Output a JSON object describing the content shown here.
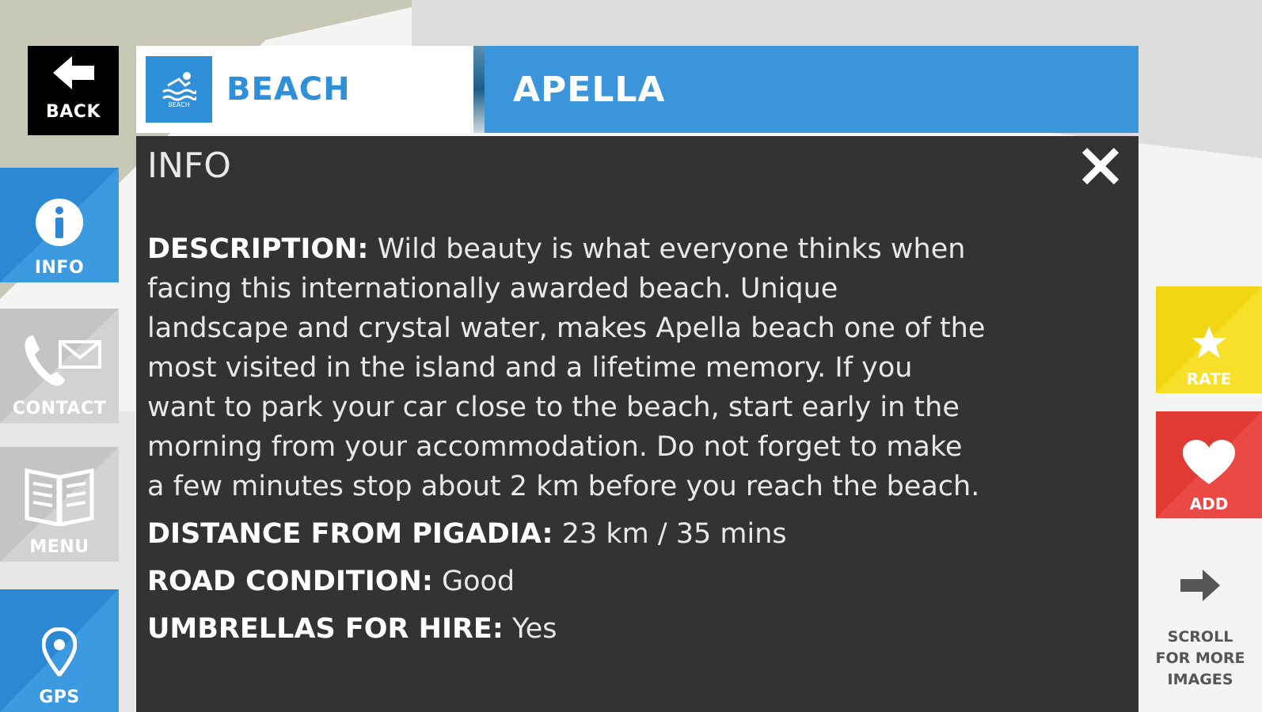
{
  "nav": {
    "back_label": "BACK",
    "info_label": "INFO",
    "contact_label": "CONTACT",
    "menu_label": "MENU",
    "gps_label": "GPS"
  },
  "header": {
    "category_icon_caption": "BEACH",
    "category_label": "BEACH",
    "place_name": "APELLA"
  },
  "panel": {
    "title": "INFO",
    "description_label": "DESCRIPTION:",
    "description_text": "Wild beauty is what everyone thinks when facing this internationally awarded beach. Unique landscape and crystal water, makes Apella beach one of the most visited in the island and a lifetime memory. If you want to park your car close to the beach, start early in the morning from your accommodation. Do not forget to make a few minutes stop about 2 km before you reach the beach.",
    "distance_label": "DISTANCE FROM PIGADIA:",
    "distance_value": "23 km / 35 mins",
    "road_label": "ROAD CONDITION:",
    "road_value": "Good",
    "umbrellas_label": "UMBRELLAS FOR HIRE:",
    "umbrellas_value": "Yes"
  },
  "actions": {
    "rate_label": "RATE",
    "add_label": "ADD",
    "scroll_hint": "SCROLL\nFOR MORE\nIMAGES"
  },
  "colors": {
    "primary_blue": "#2c88d2",
    "panel_dark": "#333333",
    "rate_yellow": "#f2d513",
    "add_red": "#e13a33"
  }
}
